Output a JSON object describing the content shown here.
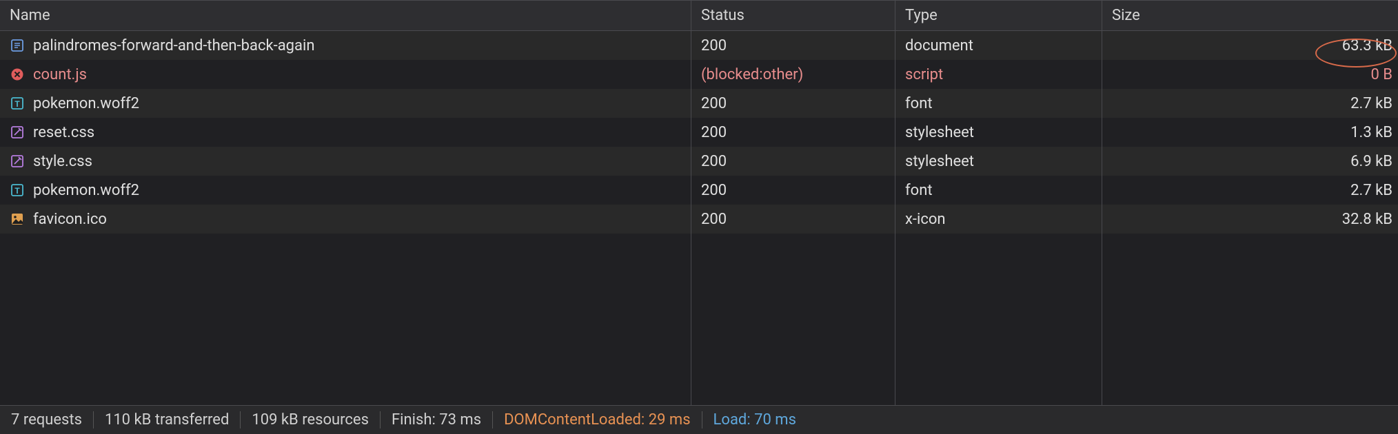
{
  "headers": {
    "name": "Name",
    "status": "Status",
    "type": "Type",
    "size": "Size"
  },
  "rows": [
    {
      "icon": "document-icon",
      "iconColor": "#6d9de2",
      "name": "palindromes-forward-and-then-back-again",
      "status": "200",
      "type": "document",
      "size": "63.3 kB",
      "error": false
    },
    {
      "icon": "error-icon",
      "iconColor": "#e05c5c",
      "name": "count.js",
      "status": "(blocked:other)",
      "type": "script",
      "size": "0 B",
      "error": true
    },
    {
      "icon": "font-icon",
      "iconColor": "#4bbad1",
      "name": "pokemon.woff2",
      "status": "200",
      "type": "font",
      "size": "2.7 kB",
      "error": false
    },
    {
      "icon": "stylesheet-icon",
      "iconColor": "#b77de0",
      "name": "reset.css",
      "status": "200",
      "type": "stylesheet",
      "size": "1.3 kB",
      "error": false
    },
    {
      "icon": "stylesheet-icon",
      "iconColor": "#b77de0",
      "name": "style.css",
      "status": "200",
      "type": "stylesheet",
      "size": "6.9 kB",
      "error": false
    },
    {
      "icon": "font-icon",
      "iconColor": "#4bbad1",
      "name": "pokemon.woff2",
      "status": "200",
      "type": "font",
      "size": "2.7 kB",
      "error": false
    },
    {
      "icon": "image-icon",
      "iconColor": "#e0a050",
      "name": "favicon.ico",
      "status": "200",
      "type": "x-icon",
      "size": "32.8 kB",
      "error": false
    }
  ],
  "footer": {
    "requests": "7 requests",
    "transferred": "110 kB transferred",
    "resources": "109 kB resources",
    "finish": "Finish: 73 ms",
    "domcontentloaded": "DOMContentLoaded: 29 ms",
    "load": "Load: 70 ms"
  }
}
